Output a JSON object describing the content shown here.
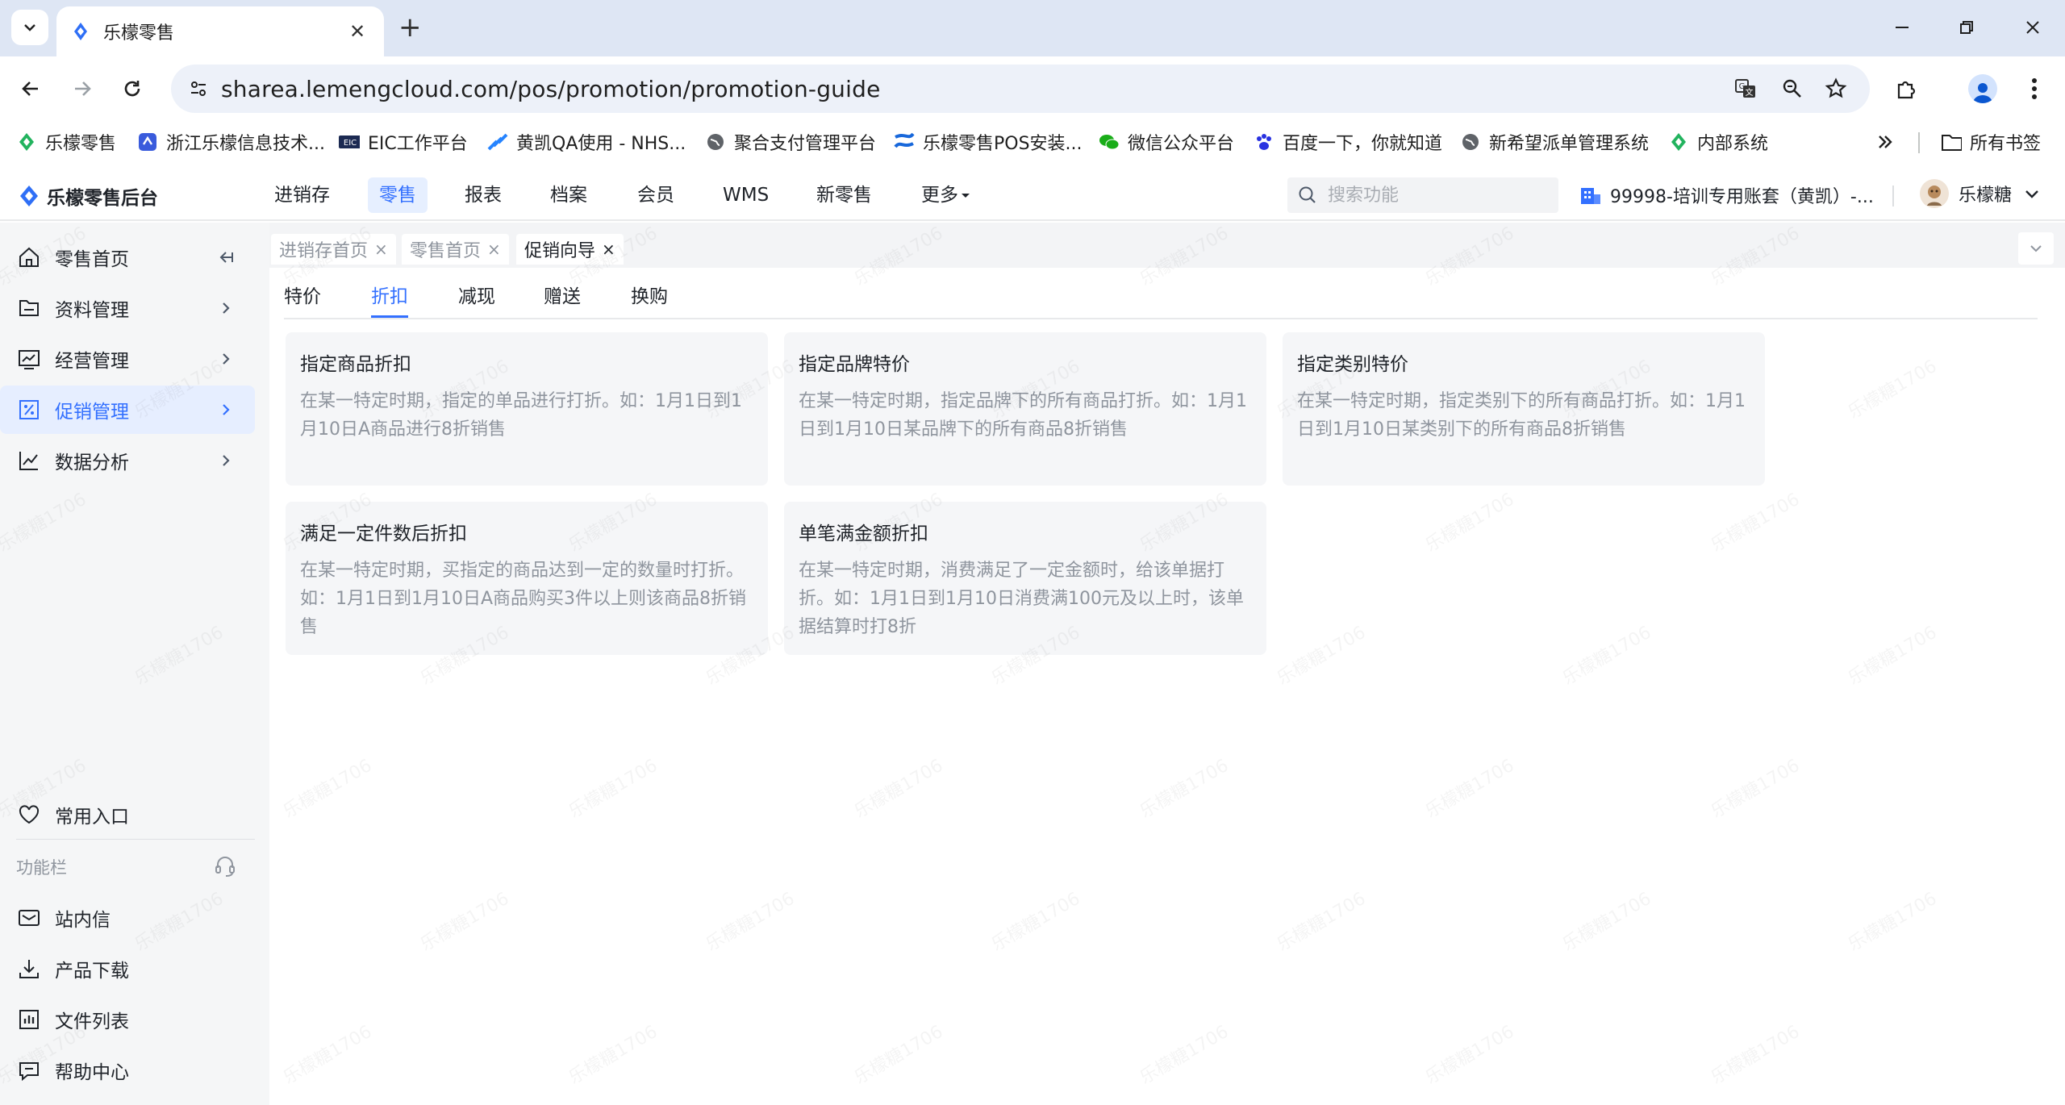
{
  "browser": {
    "tab_title": "乐檬零售",
    "url": "sharea.lemengcloud.com/pos/promotion/promotion-guide",
    "bookmarks": [
      {
        "label": "乐檬零售",
        "icon": "green-diamond-icon"
      },
      {
        "label": "浙江乐檬信息技术...",
        "icon": "blue-app-icon"
      },
      {
        "label": "EIC工作平台",
        "icon": "eic-icon"
      },
      {
        "label": "黄凯QA使用 - NHS...",
        "icon": "jira-icon"
      },
      {
        "label": "聚合支付管理平台",
        "icon": "globe-icon"
      },
      {
        "label": "乐檬零售POS安装...",
        "icon": "confluence-icon"
      },
      {
        "label": "微信公众平台",
        "icon": "wechat-icon"
      },
      {
        "label": "百度一下，你就知道",
        "icon": "baidu-paw-icon"
      },
      {
        "label": "新希望派单管理系统",
        "icon": "globe-icon"
      },
      {
        "label": "内部系统",
        "icon": "green-diamond-icon"
      }
    ],
    "all_bookmarks": "所有书签"
  },
  "app": {
    "brand": "乐檬零售后台",
    "nav": [
      "进销存",
      "零售",
      "报表",
      "档案",
      "会员",
      "WMS",
      "新零售",
      "更多"
    ],
    "active_nav": "零售",
    "search_placeholder": "搜索功能",
    "account": "99998-培训专用账套（黄凯）-...",
    "user": "乐檬糖"
  },
  "sidebar": {
    "items": [
      {
        "label": "零售首页",
        "icon": "home-icon"
      },
      {
        "label": "资料管理",
        "icon": "folder-icon"
      },
      {
        "label": "经营管理",
        "icon": "chart-board-icon"
      },
      {
        "label": "促销管理",
        "icon": "promotion-icon"
      },
      {
        "label": "数据分析",
        "icon": "line-chart-icon"
      }
    ],
    "active_item": "促销管理",
    "favorites": "常用入口",
    "section_label": "功能栏",
    "bottom_items": [
      {
        "label": "站内信",
        "icon": "mail-icon"
      },
      {
        "label": "产品下载",
        "icon": "download-icon"
      },
      {
        "label": "文件列表",
        "icon": "file-list-icon"
      },
      {
        "label": "帮助中心",
        "icon": "help-icon"
      }
    ]
  },
  "page_tabs": [
    {
      "label": "进销存首页",
      "close": "×"
    },
    {
      "label": "零售首页",
      "close": "×"
    },
    {
      "label": "促销向导",
      "close": "×"
    }
  ],
  "sub_tabs": [
    "特价",
    "折扣",
    "减现",
    "赠送",
    "换购"
  ],
  "active_sub_tab": "折扣",
  "cards": [
    {
      "title": "指定商品折扣",
      "desc": "在某一特定时期，指定的单品进行打折。如：1月1日到1月10日A商品进行8折销售"
    },
    {
      "title": "指定品牌特价",
      "desc": "在某一特定时期，指定品牌下的所有商品打折。如：1月1日到1月10日某品牌下的所有商品8折销售"
    },
    {
      "title": "指定类别特价",
      "desc": "在某一特定时期，指定类别下的所有商品打折。如：1月1日到1月10日某类别下的所有商品8折销售"
    },
    {
      "title": "满足一定件数后折扣",
      "desc": "在某一特定时期，买指定的商品达到一定的数量时打折。如：1月1日到1月10日A商品购买3件以上则该商品8折销售"
    },
    {
      "title": "单笔满金额折扣",
      "desc": "在某一特定时期，消费满足了一定金额时，给该单据打折。如：1月1日到1月10日消费满100元及以上时，该单据结算时打8折"
    }
  ],
  "watermark": "乐檬糖1706",
  "colors": {
    "accent": "#3370ff",
    "active_bg": "#e6eeff",
    "card_bg": "#f5f6f8"
  }
}
